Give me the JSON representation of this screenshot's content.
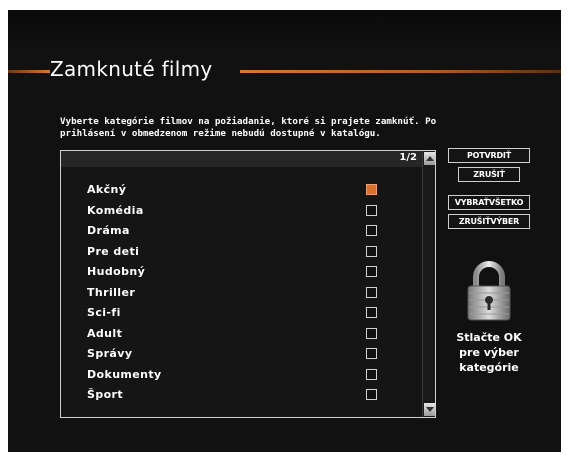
{
  "header": {
    "title": "Zamknuté filmy"
  },
  "instructions": {
    "line1": "Vyberte kategórie filmov na požiadanie, ktoré si prajete zamknúť. Po",
    "line2": "prihlásení v obmedzenom režime nebudú dostupné v katalógu."
  },
  "list": {
    "page_indicator": "1/2",
    "items": [
      {
        "label": "Akčný",
        "checked": true
      },
      {
        "label": "Komédia",
        "checked": false
      },
      {
        "label": "Dráma",
        "checked": false
      },
      {
        "label": "Pre deti",
        "checked": false
      },
      {
        "label": "Hudobný",
        "checked": false
      },
      {
        "label": "Thriller",
        "checked": false
      },
      {
        "label": "Sci-fi",
        "checked": false
      },
      {
        "label": "Adult",
        "checked": false
      },
      {
        "label": "Správy",
        "checked": false
      },
      {
        "label": "Dokumenty",
        "checked": false
      },
      {
        "label": "Šport",
        "checked": false
      }
    ]
  },
  "actions": {
    "confirm_label": "POTVRDIŤ",
    "cancel_label": "ZRUŠIŤ",
    "select_all_label": "VYBRAŤVŠETKO",
    "deselect_all_label": "ZRUŠIŤVÝBER"
  },
  "hint": {
    "line1": "Stlačte OK",
    "line2": "pre výber",
    "line3": "kategórie"
  },
  "colors": {
    "accent": "#d9702c",
    "background": "#111111"
  },
  "icons": {
    "lock": "padlock-icon"
  }
}
